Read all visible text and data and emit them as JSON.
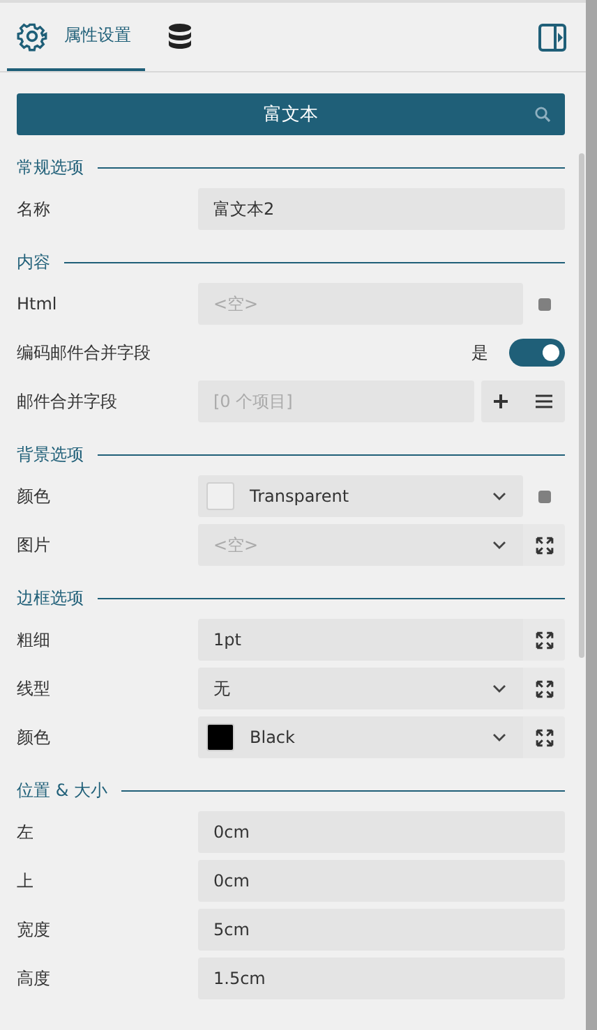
{
  "tabs": [
    {
      "kind": "gear",
      "label": "属性设置",
      "selected": true
    },
    {
      "kind": "database",
      "selected": false
    }
  ],
  "header": {
    "title": "富文本"
  },
  "sections": [
    {
      "title": "常规选项",
      "rows": [
        {
          "kind": "text",
          "label": "名称",
          "value": "富文本2"
        }
      ]
    },
    {
      "title": "内容",
      "rows": [
        {
          "kind": "text",
          "label": "Html",
          "placeholder": "<空>",
          "square_button": true
        },
        {
          "kind": "toggle",
          "label": "编码邮件合并字段",
          "state_label": "是",
          "on": true
        },
        {
          "kind": "list",
          "label": "邮件合并字段",
          "placeholder": "[0 个项目]"
        }
      ]
    },
    {
      "title": "背景选项",
      "rows": [
        {
          "kind": "select",
          "label": "颜色",
          "value": "Transparent",
          "color": "#f0f0f0",
          "square_button": true
        },
        {
          "kind": "select",
          "label": "图片",
          "placeholder": "<空>",
          "expand_button": true
        }
      ]
    },
    {
      "title": "边框选项",
      "rows": [
        {
          "kind": "text",
          "label": "粗细",
          "value": "1pt",
          "expand_button": true
        },
        {
          "kind": "select",
          "label": "线型",
          "value": "无",
          "expand_button": true
        },
        {
          "kind": "select",
          "label": "颜色",
          "value": "Black",
          "color": "#000000",
          "expand_button": true
        }
      ]
    },
    {
      "title": "位置 & 大小",
      "rows": [
        {
          "kind": "text",
          "label": "左",
          "value": "0cm"
        },
        {
          "kind": "text",
          "label": "上",
          "value": "0cm"
        },
        {
          "kind": "text",
          "label": "宽度",
          "value": "5cm"
        },
        {
          "kind": "text",
          "label": "高度",
          "value": "1.5cm"
        }
      ]
    }
  ]
}
